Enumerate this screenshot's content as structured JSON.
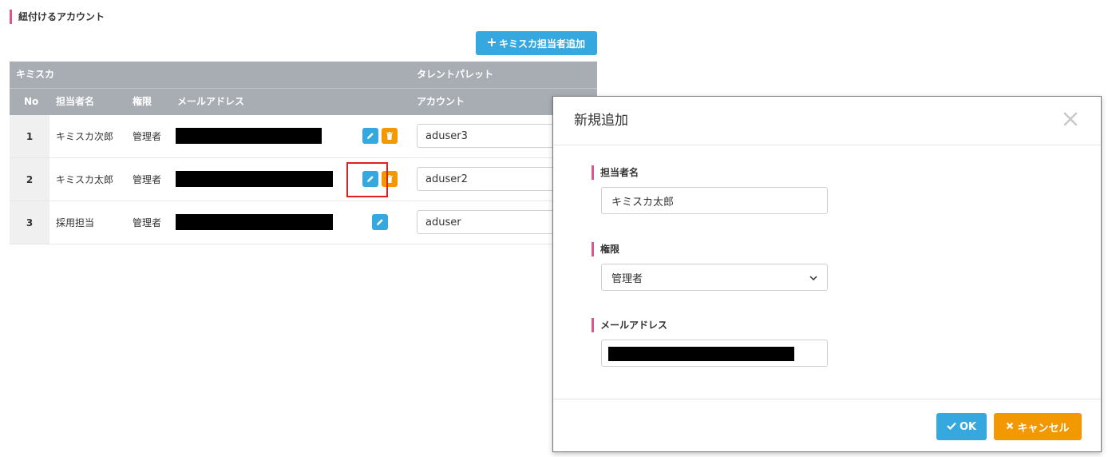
{
  "section": {
    "title": "紐付けるアカウント"
  },
  "add_button": {
    "label": "キミスカ担当者追加",
    "icon": "plus-icon"
  },
  "table": {
    "group_headers": {
      "kimisuka": "キミスカ",
      "talent": "タレントパレット"
    },
    "columns": {
      "no": "No",
      "name": "担当者名",
      "role": "権限",
      "email": "メールアドレス",
      "account": "アカウント"
    },
    "rows": [
      {
        "no": "1",
        "name": "キミスカ次郎",
        "role": "管理者",
        "account": "aduser3",
        "deletable": true
      },
      {
        "no": "2",
        "name": "キミスカ太郎",
        "role": "管理者",
        "account": "aduser2",
        "deletable": true
      },
      {
        "no": "3",
        "name": "採用担当",
        "role": "管理者",
        "account": "aduser",
        "deletable": false
      }
    ]
  },
  "modal": {
    "title": "新規追加",
    "close_icon": "close-icon",
    "fields": {
      "name": {
        "label": "担当者名",
        "value": "キミスカ太郎"
      },
      "role": {
        "label": "権限",
        "value": "管理者"
      },
      "email": {
        "label": "メールアドレス",
        "value": ""
      }
    },
    "ok_label": "OK",
    "cancel_label": "キャンセル"
  },
  "colors": {
    "accent_blue": "#35a8e0",
    "accent_orange": "#f39800",
    "header_gray": "#a8adb4",
    "label_pink": "#e0558b",
    "highlight_red": "#e0201c"
  }
}
